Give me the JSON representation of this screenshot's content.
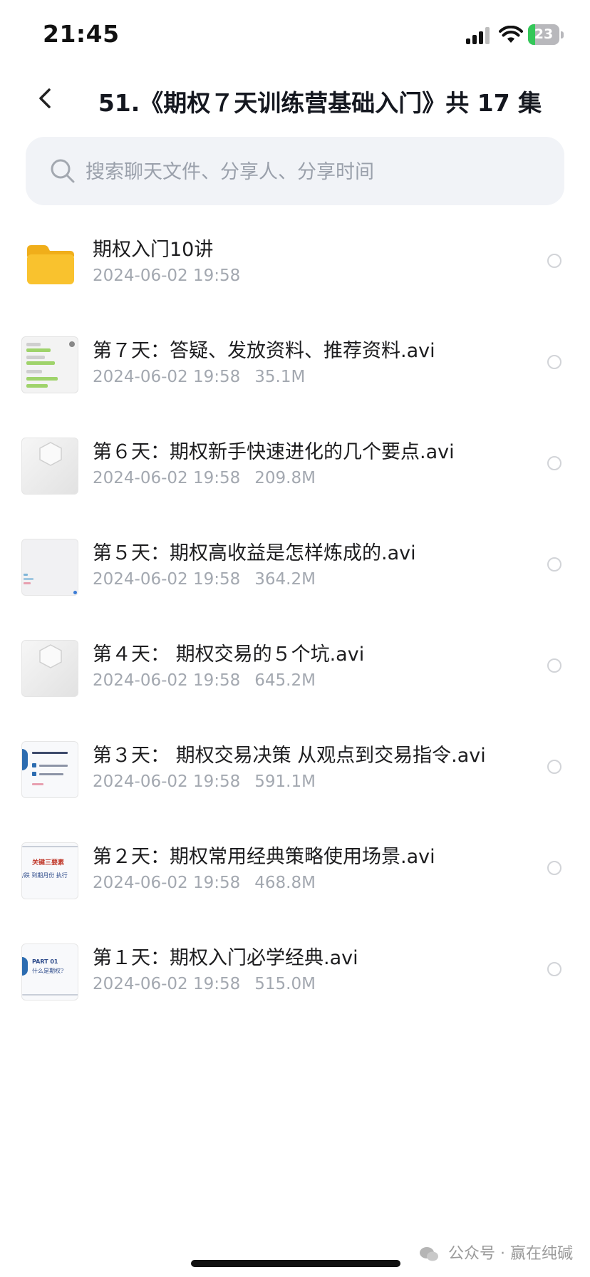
{
  "status_bar": {
    "time": "21:45",
    "battery": "23"
  },
  "header": {
    "title": "51.《期权７天训练营基础入门》共 17 集"
  },
  "search": {
    "placeholder": "搜索聊天文件、分享人、分享时间",
    "value": ""
  },
  "files": [
    {
      "name": "期权入门10讲",
      "date": "2024-06-02 19:58",
      "size": "",
      "thumb": "folder-icon"
    },
    {
      "name": "第７天：答疑、发放资料、推荐资料.avi",
      "date": "2024-06-02 19:58",
      "size": "35.1M",
      "thumb": "chat-screenshot"
    },
    {
      "name": "第６天：期权新手快速进化的几个要点.avi",
      "date": "2024-06-02 19:58",
      "size": "209.8M",
      "thumb": "hexagon-logo"
    },
    {
      "name": "第５天：期权高收益是怎样炼成的.avi",
      "date": "2024-06-02 19:58",
      "size": "364.2M",
      "thumb": "blank-slide"
    },
    {
      "name": "第４天： 期权交易的５个坑.avi",
      "date": "2024-06-02 19:58",
      "size": "645.2M",
      "thumb": "hexagon-logo"
    },
    {
      "name": "第３天： 期权交易决策 从观点到交易指令.avi",
      "date": "2024-06-02 19:58",
      "size": "591.1M",
      "thumb": "slide-list"
    },
    {
      "name": "第２天：期权常用经典策略使用场景.avi",
      "date": "2024-06-02 19:58",
      "size": "468.8M",
      "thumb": "slide-key"
    },
    {
      "name": "第１天：期权入门必学经典.avi",
      "date": "2024-06-02 19:58",
      "size": "515.0M",
      "thumb": "slide-part"
    }
  ],
  "thumb_text": {
    "slide_key_heading": "关键三要素",
    "slide_key_line": "/跌  到期月份  执行",
    "slide_part_heading": "PART 01",
    "slide_part_sub": "什么是期权?"
  },
  "watermark": "公众号 · 赢在纯碱",
  "colors": {
    "accent_green": "#34c759",
    "folder_yellow": "#f9c22e",
    "meta_gray": "#a3a8b0"
  }
}
